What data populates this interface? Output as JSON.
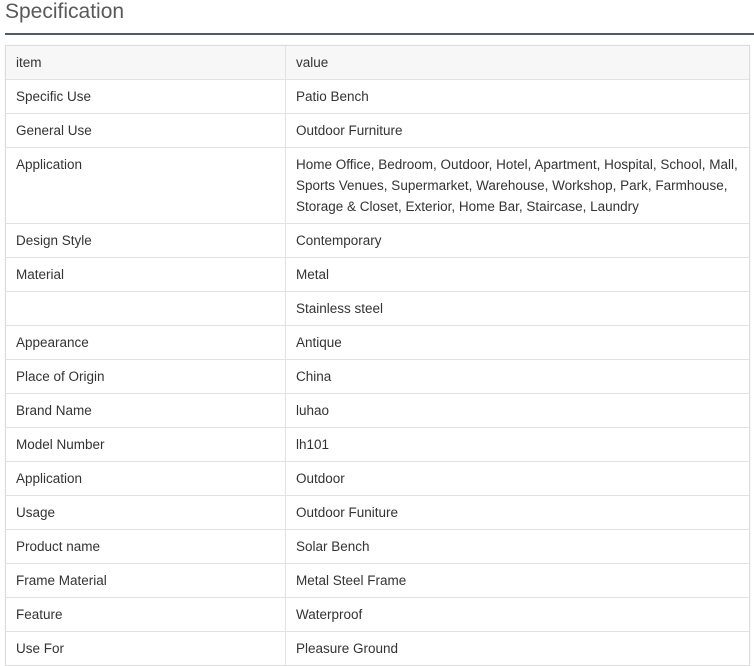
{
  "page": {
    "title": "Specification"
  },
  "table": {
    "header": {
      "item": "item",
      "value": "value"
    },
    "rows": [
      {
        "item": "Specific Use",
        "value": "Patio Bench"
      },
      {
        "item": "General Use",
        "value": "Outdoor Furniture"
      },
      {
        "item": "Application",
        "value": "Home Office, Bedroom, Outdoor, Hotel, Apartment, Hospital, School, Mall, Sports Venues, Supermarket, Warehouse, Workshop, Park, Farmhouse, Storage & Closet, Exterior, Home Bar, Staircase, Laundry"
      },
      {
        "item": "Design Style",
        "value": "Contemporary"
      },
      {
        "item": "Material",
        "value": "Metal"
      },
      {
        "item": "",
        "value": "Stainless steel"
      },
      {
        "item": "Appearance",
        "value": "Antique"
      },
      {
        "item": "Place of Origin",
        "value": "China"
      },
      {
        "item": "Brand Name",
        "value": "luhao"
      },
      {
        "item": "Model Number",
        "value": "lh101"
      },
      {
        "item": "Application",
        "value": "Outdoor"
      },
      {
        "item": "Usage",
        "value": "Outdoor Funiture"
      },
      {
        "item": "Product name",
        "value": "Solar Bench"
      },
      {
        "item": "Frame Material",
        "value": "Metal Steel Frame"
      },
      {
        "item": "Feature",
        "value": "Waterproof"
      },
      {
        "item": "Use For",
        "value": "Pleasure Ground"
      }
    ]
  }
}
